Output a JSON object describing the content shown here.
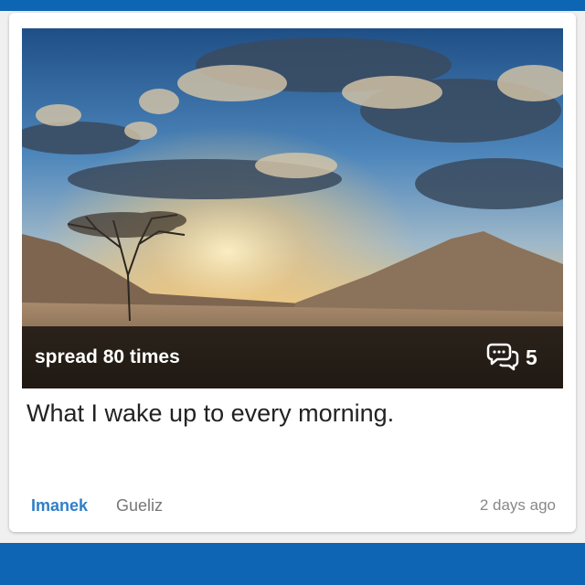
{
  "post": {
    "spread_label": "spread 80 times",
    "comment_count": "5",
    "caption": "What I wake up to every morning.",
    "author": "Imanek",
    "location": "Gueliz",
    "time_ago": "2 days ago"
  },
  "icons": {
    "comment": "comment-bubbles-icon"
  },
  "colors": {
    "brand_blue": "#0e65b4",
    "author_link": "#2f7fc7"
  }
}
